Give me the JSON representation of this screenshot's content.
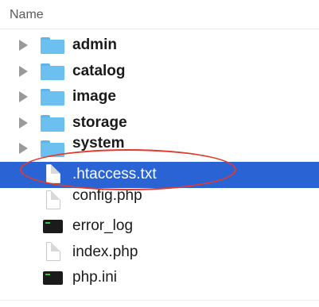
{
  "header": {
    "column_name": "Name"
  },
  "files": [
    {
      "name": "admin",
      "kind": "folder",
      "expandable": true,
      "selected": false
    },
    {
      "name": "catalog",
      "kind": "folder",
      "expandable": true,
      "selected": false
    },
    {
      "name": "image",
      "kind": "folder",
      "expandable": true,
      "selected": false
    },
    {
      "name": "storage",
      "kind": "folder",
      "expandable": true,
      "selected": false
    },
    {
      "name": "system",
      "kind": "folder",
      "expandable": true,
      "selected": false
    },
    {
      "name": ".htaccess.txt",
      "kind": "document",
      "expandable": false,
      "selected": true
    },
    {
      "name": "config.php",
      "kind": "document",
      "expandable": false,
      "selected": false
    },
    {
      "name": "error_log",
      "kind": "terminal",
      "expandable": false,
      "selected": false
    },
    {
      "name": "index.php",
      "kind": "document",
      "expandable": false,
      "selected": false
    },
    {
      "name": "php.ini",
      "kind": "terminal",
      "expandable": false,
      "selected": false
    }
  ],
  "colors": {
    "selection": "#2a63d4",
    "annotation": "#e23b2e",
    "folder": "#6cc0f0"
  }
}
